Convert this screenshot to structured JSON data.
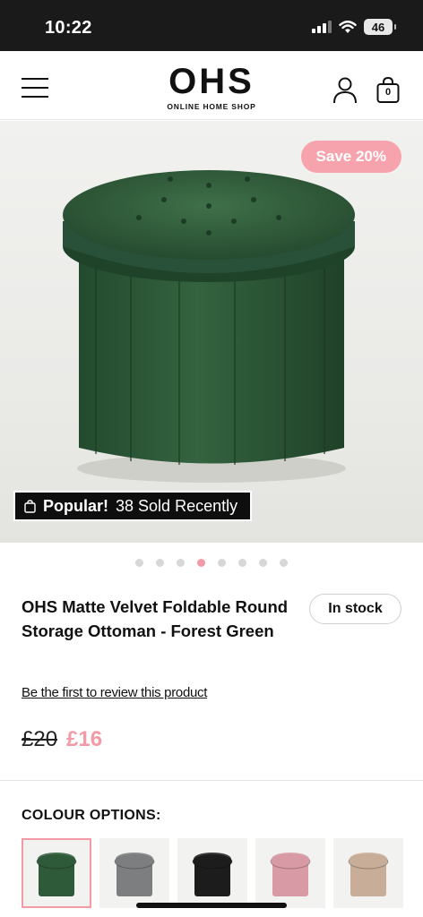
{
  "status_bar": {
    "time": "10:22",
    "battery": "46"
  },
  "header": {
    "logo": "OHS",
    "logo_subtitle": "ONLINE HOME SHOP",
    "cart_count": "0"
  },
  "hero": {
    "save_badge": "Save 20%",
    "popular_label": "Popular!",
    "popular_detail": "38 Sold Recently",
    "product_color": "#2f5a3a",
    "image_count": 8,
    "active_image_index": 3
  },
  "product": {
    "title": "OHS Matte Velvet Foldable Round Storage Ottoman - Forest Green",
    "stock_status": "In stock",
    "review_link": "Be the first to review this product",
    "price_old": "£20",
    "price_new": "£16"
  },
  "colour_options": {
    "label": "COLOUR OPTIONS:",
    "swatches": [
      {
        "name": "Forest Green",
        "color": "#2f5a3a",
        "selected": true
      },
      {
        "name": "Grey",
        "color": "#7d7e80",
        "selected": false
      },
      {
        "name": "Black",
        "color": "#1c1c1c",
        "selected": false
      },
      {
        "name": "Pink",
        "color": "#d89aa5",
        "selected": false
      },
      {
        "name": "Beige",
        "color": "#c8ad98",
        "selected": false
      }
    ]
  },
  "colors": {
    "accent_pink": "#f29aa5",
    "price_pink": "#f39aa6"
  }
}
